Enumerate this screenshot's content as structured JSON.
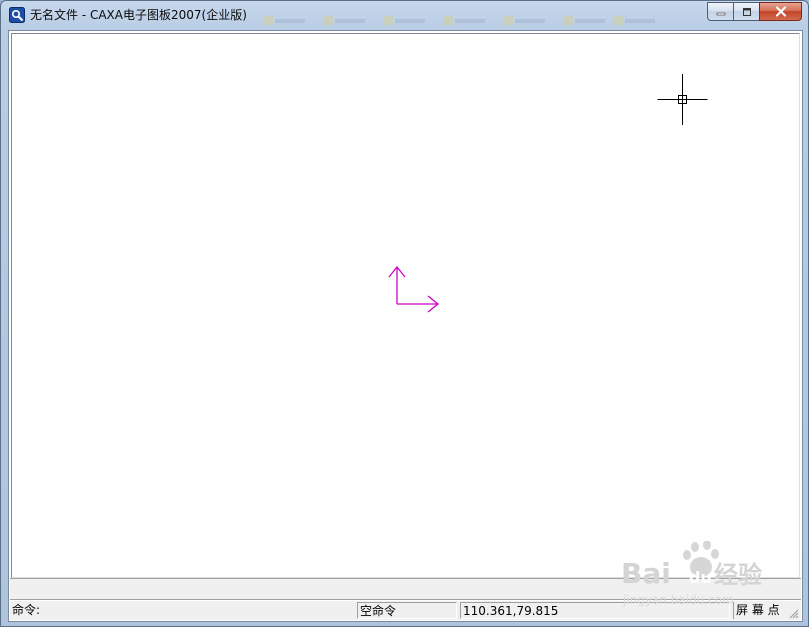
{
  "window": {
    "title": "无名文件 - CAXA电子图板2007(企业版)"
  },
  "status_bar": {
    "prompt": "命令:",
    "state": "空命令",
    "coordinates": "110.361,79.815",
    "snap_mode": "屏 幕 点"
  },
  "canvas": {
    "background": "#ffffff",
    "ucs_axis_color": "#cc00cc",
    "cursor_color": "#000000"
  },
  "icons": {
    "app": "caxa-app-icon",
    "minimize": "minimize-icon",
    "maximize": "maximize-icon",
    "close": "close-icon",
    "cursor": "crosshair-cursor-icon",
    "ucs": "ucs-axis-icon"
  },
  "watermark": {
    "brand": "Bai",
    "brand_suffix": "du",
    "product": "经验",
    "domain": "jingyan.baidu.com"
  }
}
